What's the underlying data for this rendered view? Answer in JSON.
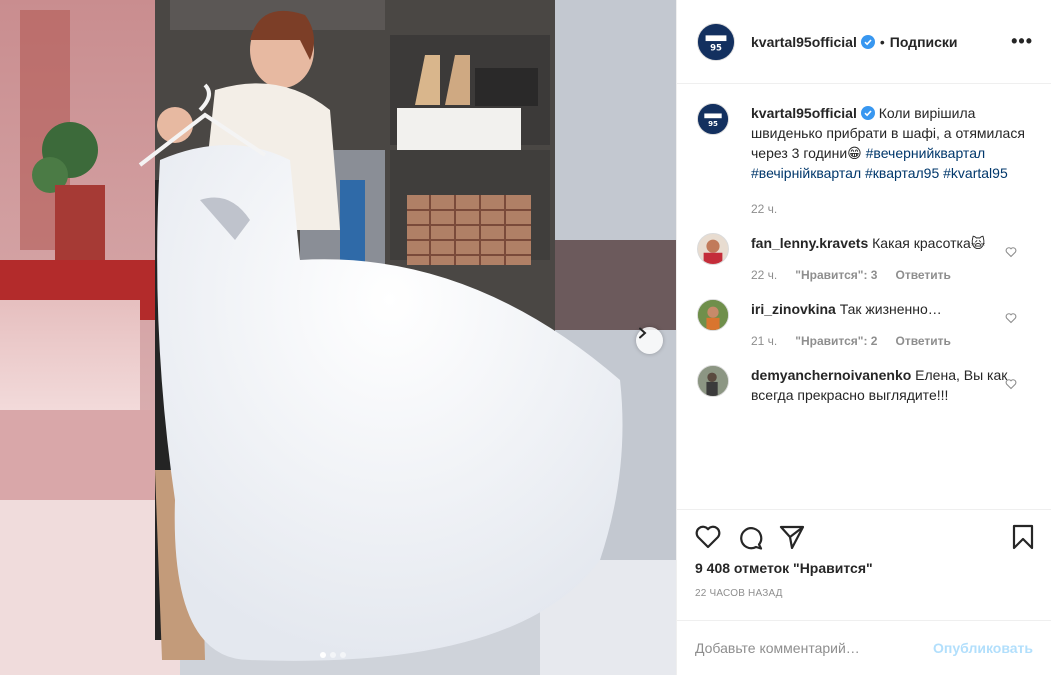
{
  "post": {
    "username": "kvartal95official",
    "follow_label": "Подписки",
    "more_label": "•••",
    "avatar_icon": "kvartal95-logo-icon"
  },
  "caption": {
    "username": "kvartal95official",
    "text": "Коли вирішила швиденько прибрати в шафі, а отямилася через 3 години😁",
    "hashtags": "#вечернийквартал #вечірнійквартал #квартал95 #kvartal95",
    "time": "22 ч."
  },
  "comments": [
    {
      "username": "fan_lenny.kravets",
      "text": "Какая красотка🙀",
      "time": "22 ч.",
      "likes": "\"Нравится\": 3",
      "reply": "Ответить"
    },
    {
      "username": "iri_zinovkina",
      "text": "Так жизненно…",
      "time": "21 ч.",
      "likes": "\"Нравится\": 2",
      "reply": "Ответить"
    },
    {
      "username": "demyanchernoivanenko",
      "text": "Елена, Вы как всегда прекрасно выглядите!!!",
      "time": "",
      "likes": "",
      "reply": ""
    }
  ],
  "stats": {
    "likes": "9 408 отметок \"Нравится\"",
    "posted": "22 часов назад"
  },
  "comment_box": {
    "placeholder": "Добавьте комментарий…",
    "publish_label": "Опубликовать"
  },
  "carousel": {
    "total": 3,
    "current": 1
  },
  "colors": {
    "link": "#00376b",
    "publish_disabled": "#b2dffc",
    "meta": "#8e8e8e"
  }
}
